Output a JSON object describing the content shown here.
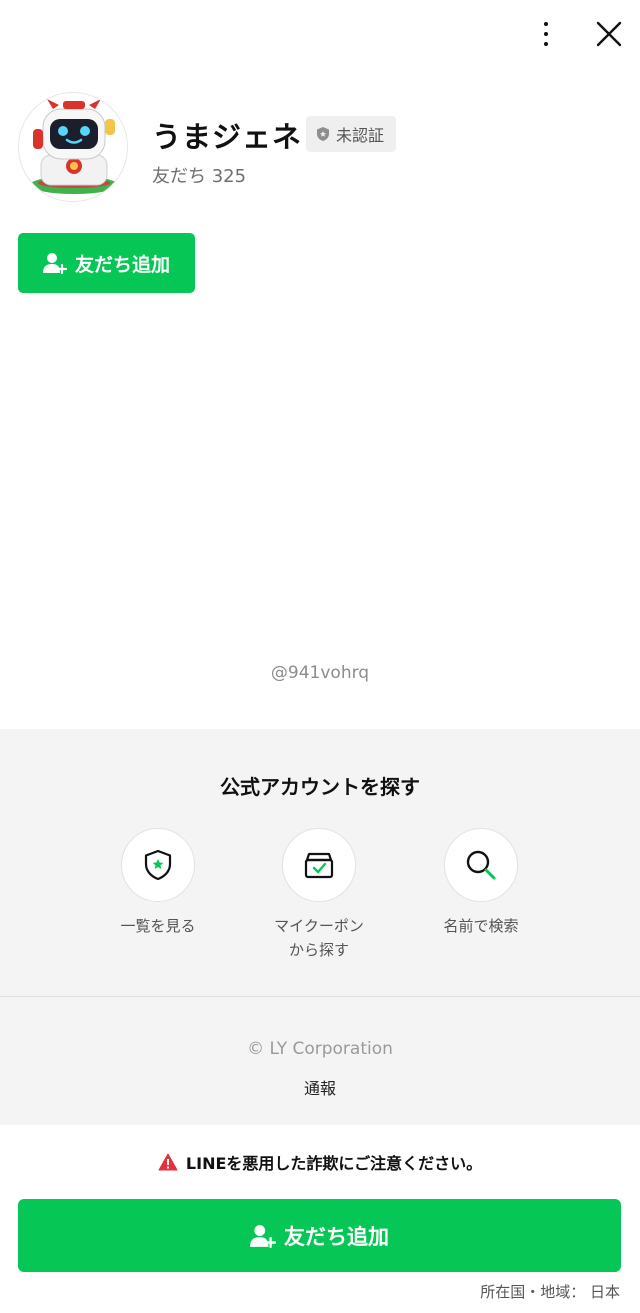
{
  "header": {
    "more_icon": "kebab-vertical-icon",
    "close_icon": "close-x-icon"
  },
  "profile": {
    "name": "うまジェネ",
    "badge": "未認証",
    "friends_count": "友だち 325",
    "avatar": "robot-mascot-avatar"
  },
  "actions": {
    "add_friend_label": "友だち追加"
  },
  "account_id": "@941vohrq",
  "discover": {
    "title": "公式アカウントを探す",
    "items": [
      {
        "label": "一覧を見る",
        "icon": "shield-star-icon"
      },
      {
        "label": "マイクーポン\nから探す",
        "icon": "coupon-box-icon"
      },
      {
        "label": "名前で検索",
        "icon": "search-icon"
      }
    ]
  },
  "footer": {
    "copyright": "© LY Corporation",
    "report": "通報"
  },
  "warning": {
    "text": "LINEを悪用した詐欺にご注意ください。"
  },
  "bottom_cta": {
    "label": "友だち追加"
  },
  "region": "所在国・地域： 日本",
  "colors": {
    "accent_green": "#06c755",
    "warning_red": "#e0323c"
  }
}
